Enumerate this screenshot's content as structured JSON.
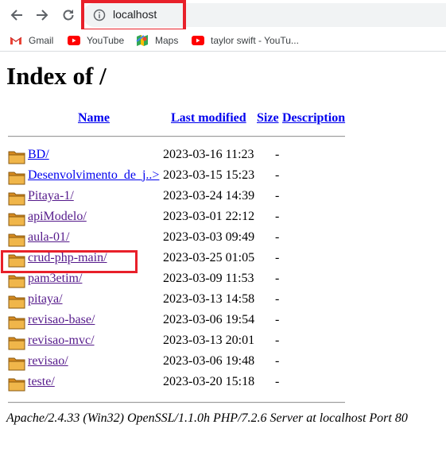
{
  "browser": {
    "url": "localhost",
    "bookmarks": [
      {
        "label": "Gmail",
        "icon": "gmail-icon"
      },
      {
        "label": "YouTube",
        "icon": "youtube-icon"
      },
      {
        "label": "Maps",
        "icon": "maps-icon"
      },
      {
        "label": "taylor swift - YouTu...",
        "icon": "youtube-icon"
      }
    ],
    "highlight_color": "#e8202a"
  },
  "page": {
    "title": "Index of /",
    "headers": {
      "name": "Name",
      "modified": "Last modified",
      "size": "Size",
      "description": "Description"
    },
    "entries": [
      {
        "name": "BD/",
        "modified": "2023-03-16 11:23",
        "size": "-",
        "visited": false
      },
      {
        "name": "Desenvolvimento_de_j..>",
        "modified": "2023-03-15 15:23",
        "size": "-",
        "visited": false
      },
      {
        "name": "Pitaya-1/",
        "modified": "2023-03-24 14:39",
        "size": "-",
        "visited": true
      },
      {
        "name": "apiModelo/",
        "modified": "2023-03-01 22:12",
        "size": "-",
        "visited": true
      },
      {
        "name": "aula-01/",
        "modified": "2023-03-03 09:49",
        "size": "-",
        "visited": true
      },
      {
        "name": "crud-php-main/",
        "modified": "2023-03-25 01:05",
        "size": "-",
        "visited": true
      },
      {
        "name": "pam3etim/",
        "modified": "2023-03-09 11:53",
        "size": "-",
        "visited": true
      },
      {
        "name": "pitaya/",
        "modified": "2023-03-13 14:58",
        "size": "-",
        "visited": true
      },
      {
        "name": "revisao-base/",
        "modified": "2023-03-06 19:54",
        "size": "-",
        "visited": true
      },
      {
        "name": "revisao-mvc/",
        "modified": "2023-03-13 20:01",
        "size": "-",
        "visited": true
      },
      {
        "name": "revisao/",
        "modified": "2023-03-06 19:48",
        "size": "-",
        "visited": true
      },
      {
        "name": "teste/",
        "modified": "2023-03-20 15:18",
        "size": "-",
        "visited": true
      }
    ],
    "footer": "Apache/2.4.33 (Win32) OpenSSL/1.1.0h PHP/7.2.6 Server at localhost Port 80"
  }
}
